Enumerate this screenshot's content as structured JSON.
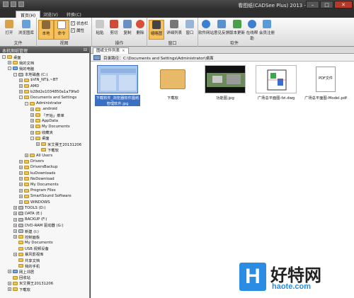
{
  "titlebar": {
    "title": "看图纸(CADSee Plus) 2013 -",
    "minimize": "–",
    "maximize": "□",
    "close": "✕"
  },
  "tabs": [
    "首页(H)",
    "浏览(V)",
    "转换(C)"
  ],
  "ribbon": {
    "groups": {
      "file": "文件",
      "view": "视图",
      "operate": "操作",
      "window": "窗口",
      "software": "软件"
    },
    "buttons": {
      "open": "打开",
      "browse": "浏览图库",
      "local": "本地",
      "command": "命令",
      "statusbar": "状态栏",
      "property": "属性",
      "paste": "粘贴",
      "cut": "剪切",
      "copy": "复制",
      "delete": "删除",
      "thumbnail": "缩略图",
      "details": "详细列表",
      "window": "窗口",
      "website": "软件网站",
      "feedback": "意见反馈",
      "update": "版本更新",
      "help": "在线帮助",
      "register": "会员注册"
    }
  },
  "left_panel": {
    "title": "本机图纸管理",
    "tree": [
      {
        "label": "桌面",
        "indent": 0,
        "icon": "folder",
        "exp": "-"
      },
      {
        "label": "我的文档",
        "indent": 1,
        "icon": "folder",
        "exp": "+"
      },
      {
        "label": "我的电脑",
        "indent": 1,
        "icon": "pc",
        "exp": "-"
      },
      {
        "label": "本地磁盘 (C:)",
        "indent": 2,
        "icon": "drive",
        "exp": "-"
      },
      {
        "label": "$VIN_NT$.~BT",
        "indent": 3,
        "icon": "folder",
        "exp": "+"
      },
      {
        "label": "AMD",
        "indent": 3,
        "icon": "folder",
        "exp": "+"
      },
      {
        "label": "b28d2e1034850a1a79fa0",
        "indent": 3,
        "icon": "folder",
        "exp": "+"
      },
      {
        "label": "Documents and Settings",
        "indent": 3,
        "icon": "folder",
        "exp": "-"
      },
      {
        "label": "Administrator",
        "indent": 4,
        "icon": "folder",
        "exp": "-"
      },
      {
        "label": ".android",
        "indent": 5,
        "icon": "folder",
        "exp": "+"
      },
      {
        "label": "「开始」菜单",
        "indent": 5,
        "icon": "folder",
        "exp": "+"
      },
      {
        "label": "AppData",
        "indent": 5,
        "icon": "folder",
        "exp": "+"
      },
      {
        "label": "My Documents",
        "indent": 5,
        "icon": "folder",
        "exp": "+"
      },
      {
        "label": "收藏夹",
        "indent": 5,
        "icon": "folder",
        "exp": "+"
      },
      {
        "label": "桌面",
        "indent": 5,
        "icon": "folder",
        "exp": "-"
      },
      {
        "label": "米艾赛王20131206",
        "indent": 6,
        "icon": "folder",
        "exp": "+"
      },
      {
        "label": "下载软",
        "indent": 6,
        "icon": "folder",
        "exp": ""
      },
      {
        "label": "All Users",
        "indent": 4,
        "icon": "folder",
        "exp": "+"
      },
      {
        "label": "Drivers",
        "indent": 3,
        "icon": "folder",
        "exp": "+"
      },
      {
        "label": "DriversBackup",
        "indent": 3,
        "icon": "folder",
        "exp": "+"
      },
      {
        "label": "kuDownloads",
        "indent": 3,
        "icon": "folder",
        "exp": "+"
      },
      {
        "label": "NeDownload",
        "indent": 3,
        "icon": "folder",
        "exp": "+"
      },
      {
        "label": "My Documents",
        "indent": 3,
        "icon": "folder",
        "exp": "+"
      },
      {
        "label": "Program Files",
        "indent": 3,
        "icon": "folder",
        "exp": "+"
      },
      {
        "label": "SmartSound Software",
        "indent": 3,
        "icon": "folder",
        "exp": "+"
      },
      {
        "label": "WINDOWS",
        "indent": 3,
        "icon": "folder",
        "exp": "+"
      },
      {
        "label": "TOOLS (D:)",
        "indent": 2,
        "icon": "drive",
        "exp": "+"
      },
      {
        "label": "DATA (E:)",
        "indent": 2,
        "icon": "drive",
        "exp": "+"
      },
      {
        "label": "BACKUP (F:)",
        "indent": 2,
        "icon": "drive",
        "exp": "+"
      },
      {
        "label": "DVD-RAM 驱动器 (G:)",
        "indent": 2,
        "icon": "drive",
        "exp": "+"
      },
      {
        "label": "新建 (I:)",
        "indent": 2,
        "icon": "drive",
        "exp": "+"
      },
      {
        "label": "控制面板",
        "indent": 2,
        "icon": "folder",
        "exp": "+"
      },
      {
        "label": "My Documents",
        "indent": 2,
        "icon": "folder",
        "exp": ""
      },
      {
        "label": "USB 视频设备",
        "indent": 2,
        "icon": "folder",
        "exp": ""
      },
      {
        "label": "暴风影视库",
        "indent": 2,
        "icon": "folder",
        "exp": "+"
      },
      {
        "label": "共享文档",
        "indent": 2,
        "icon": "folder",
        "exp": ""
      },
      {
        "label": "我的手机",
        "indent": 2,
        "icon": "folder",
        "exp": ""
      },
      {
        "label": "网上邻居",
        "indent": 1,
        "icon": "pc",
        "exp": "+"
      },
      {
        "label": "回收站",
        "indent": 1,
        "icon": "folder",
        "exp": ""
      },
      {
        "label": "米艾赛王20131206",
        "indent": 1,
        "icon": "folder",
        "exp": "+"
      },
      {
        "label": "下载软",
        "indent": 1,
        "icon": "folder",
        "exp": "+"
      }
    ]
  },
  "content": {
    "tab_label": "图纸文件列表",
    "tab_close": "×",
    "path_label": "目录路径：",
    "path": "C:\\Documents and Settings\\Administrator\\桌面",
    "files": [
      {
        "name": "下载软件_浏览器软件图纸管理软件.jpg",
        "type": "selected-image"
      },
      {
        "name": "下载软",
        "type": "folder"
      },
      {
        "name": "功能图.jpg",
        "type": "image"
      },
      {
        "name": "广场总平面图-fzi.dwg",
        "type": "dwg"
      },
      {
        "name": "广场总平面图-Model.pdf",
        "type": "pdf",
        "preview": "PDF文件"
      }
    ]
  },
  "watermark": {
    "logo": "H",
    "name": "好特网",
    "url": "haote.com"
  },
  "colors": {
    "accent": "#2a8de3",
    "selection": "#3a6fc4",
    "folder": "#e9c55a"
  }
}
